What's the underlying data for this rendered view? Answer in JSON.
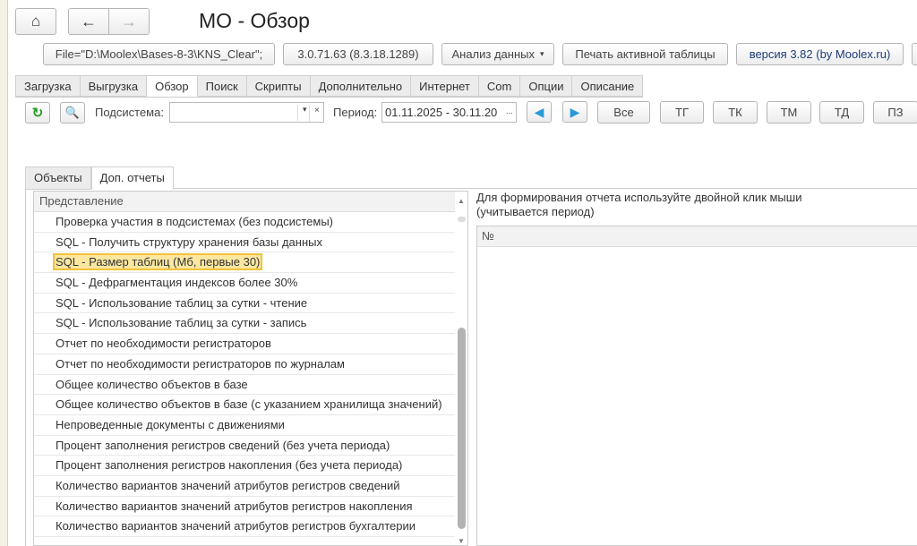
{
  "header": {
    "title": "МО - Обзор"
  },
  "toolbar": {
    "file": "File=\"D:\\Moolex\\Bases-8-3\\KNS_Clear\";",
    "version_platform": "3.0.71.63 (8.3.18.1289)",
    "analysis": "Анализ данных",
    "print": "Печать активной таблицы",
    "version": "версия 3.82 (by Moolex.ru)"
  },
  "tabs": [
    "Загрузка",
    "Выгрузка",
    "Обзор",
    "Поиск",
    "Скрипты",
    "Дополнительно",
    "Интернет",
    "Com",
    "Опции",
    "Описание"
  ],
  "filter": {
    "subsystem_label": "Подсистема:",
    "subsystem_value": "",
    "period_label": "Период:",
    "period_value": "01.11.2025 - 30.11.20",
    "buttons": [
      "Все",
      "ТГ",
      "ТК",
      "ТМ",
      "ТД",
      "ПЗ"
    ]
  },
  "subtabs": [
    "Объекты",
    "Доп. отчеты"
  ],
  "list": {
    "header": "Представление",
    "selected_index": 2,
    "items": [
      "Проверка участия в подсистемах (без подсистемы)",
      "SQL - Получить структуру хранения базы данных",
      "SQL - Размер таблиц (Мб, первые 30)",
      "SQL - Дефрагментация индексов более 30%",
      "SQL - Использование таблиц за сутки - чтение",
      "SQL - Использование таблиц за сутки - запись",
      "Отчет по необходимости регистраторов",
      "Отчет по необходимости регистраторов по журналам",
      "Общее количество объектов в базе",
      "Общее количество объектов в базе (с указанием хранилища значений)",
      "Непроведенные документы с движениями",
      "Процент заполнения регистров сведений (без учета периода)",
      "Процент заполнения регистров накопления (без учета периода)",
      "Количество вариантов значений атрибутов регистров сведений",
      "Количество вариантов значений атрибутов регистров накопления",
      "Количество вариантов значений атрибутов регистров бухгалтерии"
    ]
  },
  "report": {
    "hint_line1": "Для формирования отчета используйте двойной клик мыши",
    "hint_line2": "(учитывается период)",
    "column": "№"
  }
}
